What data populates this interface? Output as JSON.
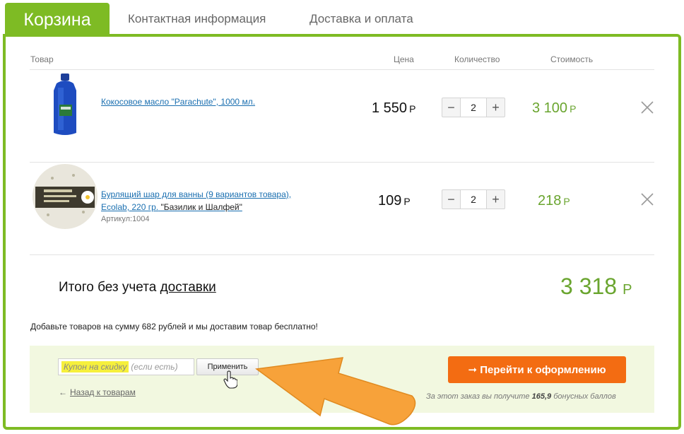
{
  "tabs": {
    "active": "Корзина",
    "contacts": "Контактная информация",
    "delivery": "Доставка и оплата"
  },
  "table": {
    "headers": {
      "product": "Товар",
      "price": "Цена",
      "quantity": "Количество",
      "cost": "Стоимость"
    }
  },
  "items": [
    {
      "name": "Кокосовое масло \"Parachute\", 1000 мл.",
      "price": "1 550",
      "currency": "Р",
      "quantity": "2",
      "cost": "3 100"
    },
    {
      "name": "Бурлящий шар для ванны (9 вариантов товара), Ecolab, 220 гр.",
      "variant": "\"Базилик и Шалфей\"",
      "sku": "Артикул:1004",
      "price": "109",
      "currency": "Р",
      "quantity": "2",
      "cost": "218"
    }
  ],
  "totals": {
    "label": "Итого без учета",
    "link": "доставки",
    "value": "3 318",
    "currency": "Р",
    "free_note": "Добавьте товаров на сумму 682 рублей и мы доставим товар бесплатно!"
  },
  "coupon": {
    "placeholder": "Купон на скидку",
    "hint": "(если есть)",
    "apply_label": "Применить"
  },
  "nav": {
    "back_arrow": "←",
    "back_label": "Назад к товарам"
  },
  "checkout": {
    "label": "➞ Перейти к оформлению",
    "bonus_prefix": "За этот заказ вы получите",
    "bonus_points": "165,9",
    "bonus_suffix": "бонусных баллов"
  },
  "colors": {
    "accent": "#7ebb24",
    "price_green": "#6aa52f",
    "checkout_orange": "#f36c12",
    "link_blue": "#1a6fb0"
  }
}
